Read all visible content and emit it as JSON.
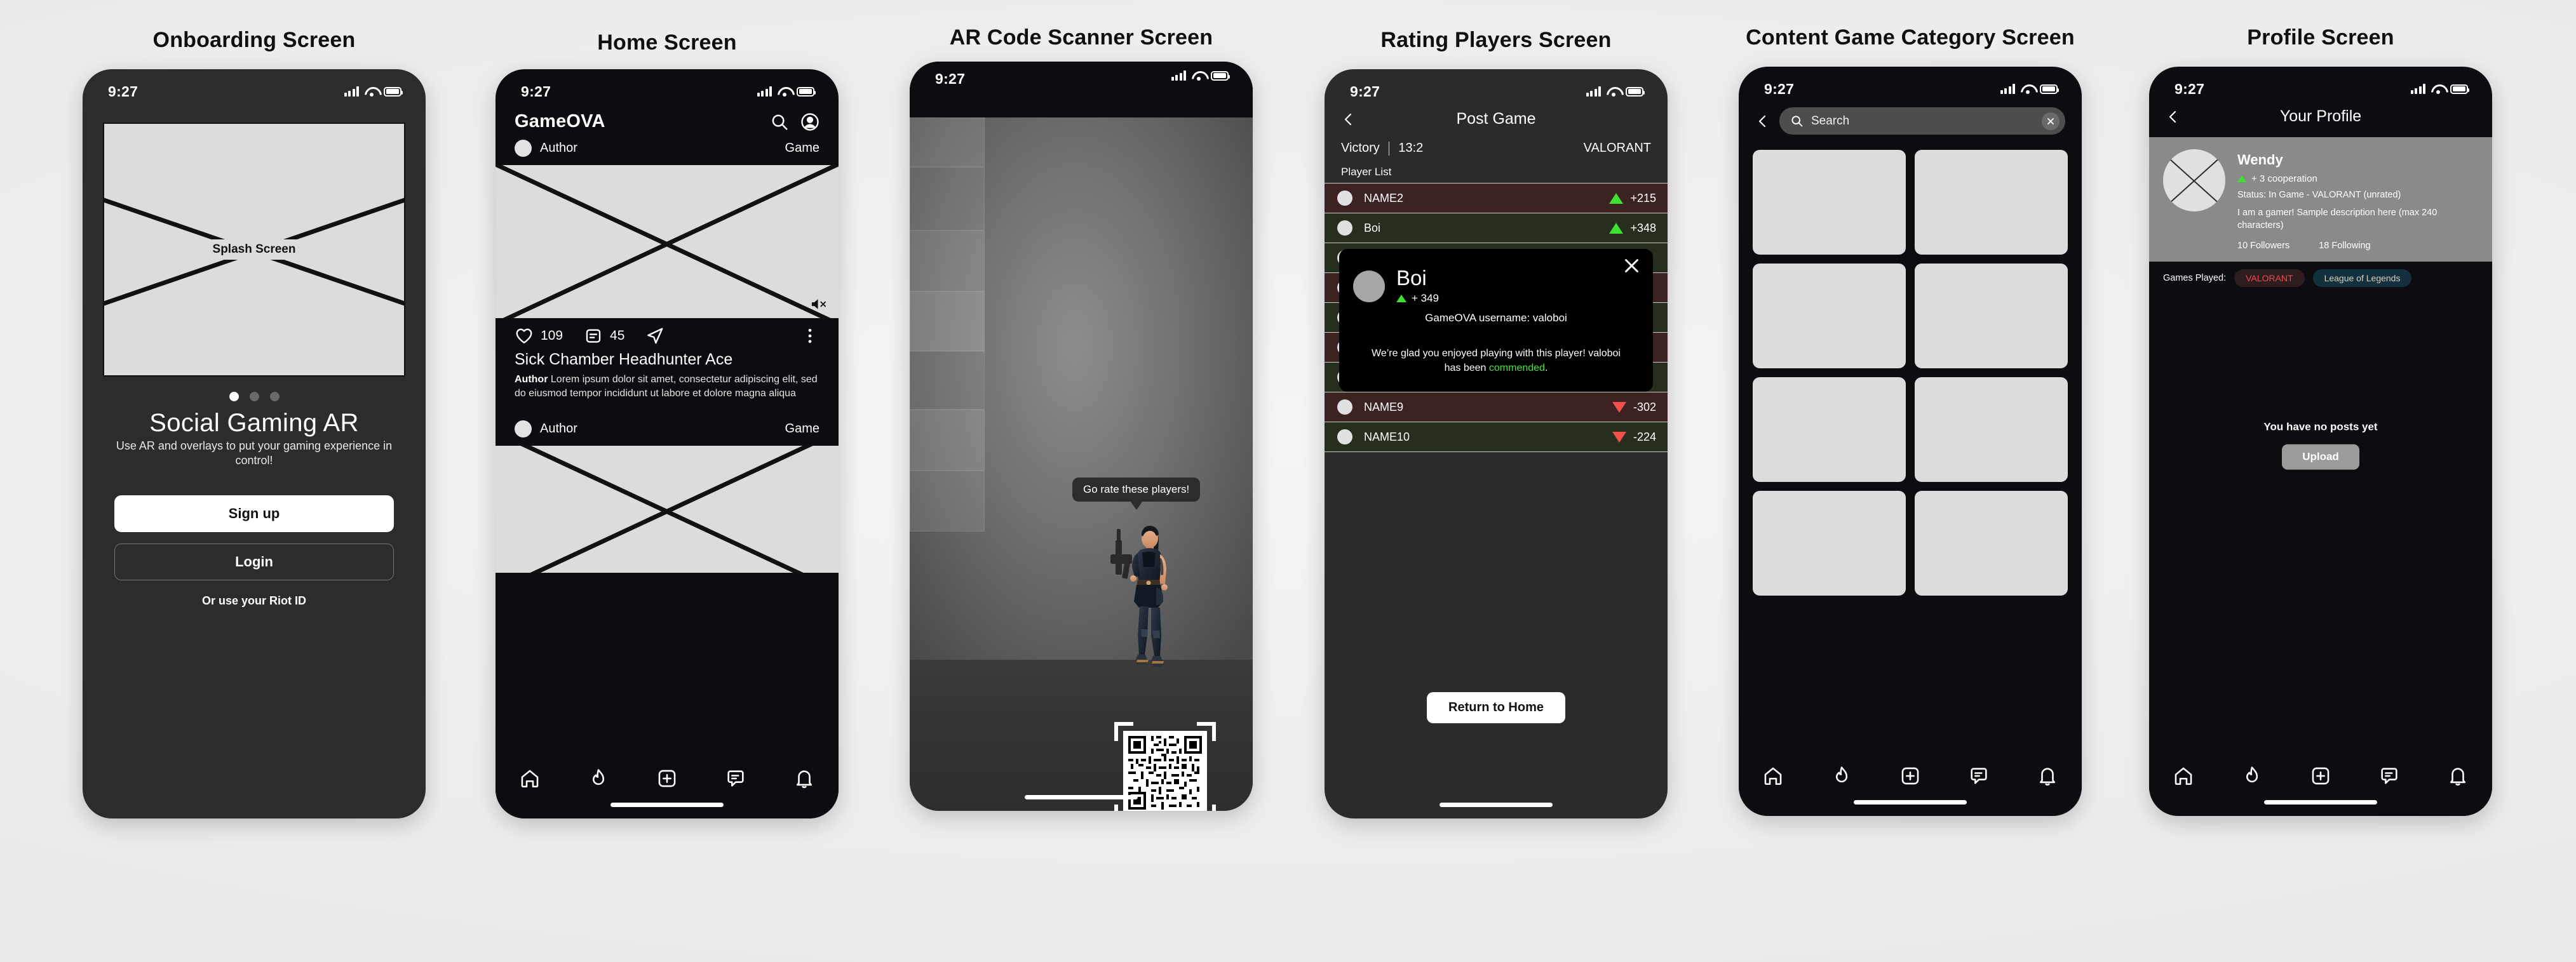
{
  "status_bar": {
    "time": "9:27"
  },
  "screens": [
    {
      "title": "Onboarding Screen",
      "splash_label": "Splash Screen",
      "heading": "Social Gaming AR",
      "subheading": "Use AR and overlays to put your gaming experience in control!",
      "signup_label": "Sign up",
      "login_label": "Login",
      "riot_label": "Or use your Riot ID",
      "dots": 3,
      "active_dot": 0
    },
    {
      "title": "Home Screen",
      "brand": "GameOVA",
      "post1": {
        "author": "Author",
        "game": "Game"
      },
      "post_actions": {
        "likes": "109",
        "comments": "45"
      },
      "post_title": "Sick Chamber Headhunter Ace",
      "post_author": "Author",
      "post_text": "Lorem ipsum dolor sit amet, consectetur adipiscing elit, sed do eiusmod tempor incididunt ut labore et dolore magna aliqua",
      "post2": {
        "author": "Author",
        "game": "Game"
      }
    },
    {
      "title": "AR Code Scanner Screen",
      "bubble": "Go rate these players!"
    },
    {
      "title": "Rating Players Screen",
      "nav_title": "Post Game",
      "result": "Victory",
      "score": "13:2",
      "game": "VALORANT",
      "list_label": "Player List",
      "players": [
        {
          "name": "NAME2",
          "delta": "+215",
          "dir": "up",
          "tint": "red"
        },
        {
          "name": "Boi",
          "delta": "+348",
          "dir": "up",
          "tint": "green"
        },
        {
          "name": "NAME9",
          "delta": "-302",
          "dir": "down",
          "tint": "red"
        },
        {
          "name": "NAME10",
          "delta": "-224",
          "dir": "down",
          "tint": "green"
        }
      ],
      "hidden_rows": [
        "green",
        "red",
        "green",
        "red",
        "green",
        "red"
      ],
      "modal": {
        "name": "Boi",
        "score": "+ 349",
        "username_line": "GameOVA username: valoboi",
        "message_pre": "We’re glad you enjoyed playing with this player! valoboi has been ",
        "message_hl": "commended",
        "message_post": "."
      },
      "return_label": "Return to Home"
    },
    {
      "title": "Content Game Category Screen",
      "search_placeholder": "Search",
      "tiles": 8
    },
    {
      "title": "Profile Screen",
      "nav_title": "Your Profile",
      "name": "Wendy",
      "cooperation": "+ 3 cooperation",
      "status": "Status: In Game - VALORANT (unrated)",
      "description": "I am a gamer! Sample description here (max 240 characters)",
      "followers": "10 Followers",
      "following": "18 Following",
      "games_label": "Games Played:",
      "games": [
        {
          "name": "VALORANT",
          "style": "val"
        },
        {
          "name": "League of Legends",
          "style": "lol"
        }
      ],
      "empty_text": "You have no posts yet",
      "upload_label": "Upload"
    }
  ],
  "colors": {
    "page_bg": "#efefef",
    "phone_dark": "#0d0d11",
    "phone_grey": "#2b2b2b",
    "accent_up": "#3ee031",
    "accent_down": "#f2504a",
    "valorant": "#ef4a52",
    "lol": "#d8cfb6",
    "placeholder": "#dcdcdc"
  },
  "nav_icons": [
    "home-icon",
    "flame-icon",
    "plus-square-icon",
    "chat-icon",
    "bell-icon"
  ]
}
